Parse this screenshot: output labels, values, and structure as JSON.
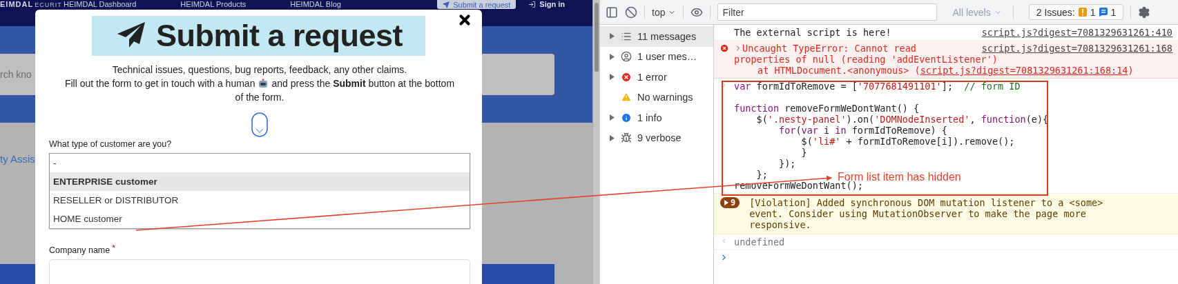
{
  "background_page": {
    "logo": "EIMDAL",
    "logo_tagline": "ECURIT",
    "nav_links": [
      "HEIMDAL Dashboard",
      "HEIMDAL Products",
      "HEIMDAL Blog"
    ],
    "submit_button": "Submit a request",
    "sign_in": "Sign in",
    "search_placeholder": "rch kno",
    "side_link": "ty Assis"
  },
  "modal": {
    "title": "Submit a request",
    "description": [
      "Technical issues, questions, bug reports, feedback, any other claims.",
      "Fill out the form to get in touch with a human",
      "and press the **Submit** button at the bottom",
      "of the form."
    ],
    "customer_type": {
      "label": "What type of customer are you?",
      "options": [
        {
          "label": "-",
          "selected": false
        },
        {
          "label": "ENTERPRISE customer",
          "selected": true
        },
        {
          "label": "RESELLER or DISTRIBUTOR",
          "selected": false
        },
        {
          "label": "HOME customer",
          "selected": false
        }
      ]
    },
    "company_name": {
      "label": "Company name",
      "required_mark": "*"
    }
  },
  "devtools": {
    "toolbar": {
      "context": "top",
      "filter_placeholder": "Filter",
      "levels": "All levels",
      "issues": {
        "label": "2 Issues:",
        "warnings": "1",
        "messages": "1"
      }
    },
    "sidebar": [
      {
        "kind": "list",
        "label": "11 messages",
        "selected": true,
        "expandable": true
      },
      {
        "kind": "user",
        "label": "1 user mes…",
        "selected": false,
        "expandable": true
      },
      {
        "kind": "error",
        "label": "1 error",
        "selected": false,
        "expandable": true
      },
      {
        "kind": "warning",
        "label": "No warnings",
        "selected": false,
        "expandable": false
      },
      {
        "kind": "info",
        "label": "1 info",
        "selected": false,
        "expandable": true
      },
      {
        "kind": "verbose",
        "label": "9 verbose",
        "selected": false,
        "expandable": true
      }
    ],
    "console": [
      {
        "kind": "log",
        "text": "The external script is here!",
        "source": "script.js?digest=7081329631261:410"
      },
      {
        "kind": "error",
        "lines": [
          "Uncaught TypeError: Cannot read",
          "properties of null (reading 'addEventListener')"
        ],
        "source": "script.js?digest=7081329631261:168",
        "stack_prefix": "at HTMLDocument.<anonymous> (",
        "stack_link": "script.js?digest=7081329631261:168:14",
        "stack_suffix": ")"
      },
      {
        "kind": "input",
        "blocks": [
          [
            [
              {
                "kind": "keyword",
                "text": "var"
              },
              {
                "kind": "plain",
                "text": " formIdToRemove = ["
              },
              {
                "kind": "string",
                "text": "'7077681491101'"
              },
              {
                "kind": "plain",
                "text": "];  "
              },
              {
                "kind": "comment",
                "text": "// form ID"
              }
            ]
          ],
          [
            [
              {
                "kind": "keyword",
                "text": "function"
              },
              {
                "kind": "plain",
                "text": " removeFormWeDontWant() {"
              }
            ],
            [
              {
                "kind": "plain",
                "text": "    $("
              },
              {
                "kind": "string",
                "text": "'.nesty-panel'"
              },
              {
                "kind": "plain",
                "text": ").on("
              },
              {
                "kind": "string",
                "text": "'DOMNodeInserted'"
              },
              {
                "kind": "plain",
                "text": ", "
              },
              {
                "kind": "keyword",
                "text": "function"
              },
              {
                "kind": "plain",
                "text": "(e){"
              }
            ],
            [
              {
                "kind": "keyword",
                "text": "        for"
              },
              {
                "kind": "plain",
                "text": "("
              },
              {
                "kind": "keyword",
                "text": "var"
              },
              {
                "kind": "plain",
                "text": " i "
              },
              {
                "kind": "keyword",
                "text": "in"
              },
              {
                "kind": "plain",
                "text": " formIdToRemove) {"
              }
            ],
            [
              {
                "kind": "plain",
                "text": "            $("
              },
              {
                "kind": "string",
                "text": "'li#'"
              },
              {
                "kind": "plain",
                "text": " + formIdToRemove[i]).remove();"
              }
            ],
            [
              {
                "kind": "plain",
                "text": "            }"
              }
            ],
            [
              {
                "kind": "plain",
                "text": "        });"
              }
            ],
            [
              {
                "kind": "plain",
                "text": "    };"
              }
            ],
            [
              {
                "kind": "plain",
                "text": "removeFormWeDontWant();"
              }
            ]
          ]
        ]
      },
      {
        "kind": "violation",
        "count": "9",
        "text": "[Violation] Added synchronous DOM mutation listener to a <some> event. Consider using MutationObserver to make the page more responsive."
      },
      {
        "kind": "result",
        "text": "undefined"
      },
      {
        "kind": "prompt"
      }
    ]
  },
  "annotation": {
    "label": "Form list item has hidden"
  }
}
